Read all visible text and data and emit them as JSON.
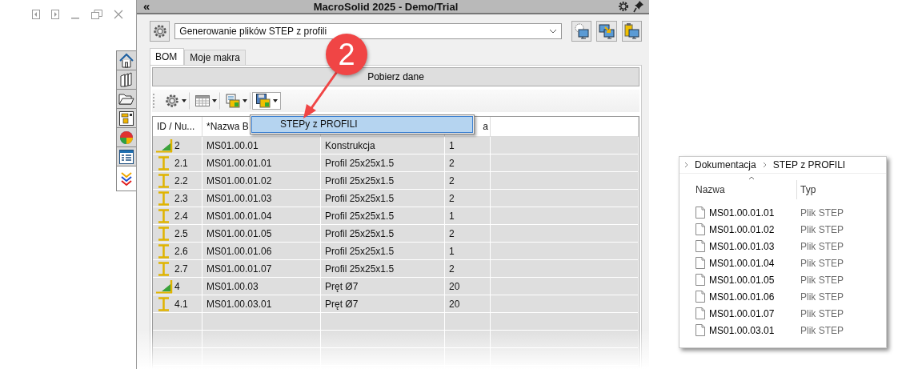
{
  "panel": {
    "collapse_glyph": "«",
    "title": "MacroSolid 2025 - Demo/Trial"
  },
  "side_tabs": [
    {
      "kind": "home",
      "selected": false
    },
    {
      "kind": "books",
      "selected": false
    },
    {
      "kind": "folder",
      "selected": false
    },
    {
      "kind": "layout",
      "selected": false
    },
    {
      "kind": "color",
      "selected": false
    },
    {
      "kind": "list",
      "selected": false
    },
    {
      "kind": "chevrons",
      "selected": true
    }
  ],
  "macro_combo": {
    "value": "Generowanie plików STEP z profili"
  },
  "tabs": [
    {
      "label": "BOM",
      "selected": true
    },
    {
      "label": "Moje makra",
      "selected": false
    }
  ],
  "fetch_button": {
    "label": "Pobierz dane"
  },
  "toolbar": [
    {
      "kind": "gear",
      "pressed": false
    },
    {
      "kind": "table",
      "pressed": false
    },
    {
      "kind": "export",
      "pressed": false
    },
    {
      "kind": "save",
      "pressed": true
    }
  ],
  "dropdown_menu": {
    "items": [
      {
        "label": "STEPy z PROFILI",
        "selected": true
      }
    ]
  },
  "table": {
    "columns": {
      "column_1": "ID / Nu...",
      "column_2": "*Nazwa B",
      "column_4": "a"
    },
    "rows": [
      {
        "kind": "assembly",
        "id": "2",
        "name": "MS01.00.01",
        "description": "Konstrukcja",
        "quantity": "1"
      },
      {
        "kind": "profile",
        "id": "2.1",
        "name": "MS01.00.01.01",
        "description": "Profil 25x25x1.5",
        "quantity": "2"
      },
      {
        "kind": "profile",
        "id": "2.2",
        "name": "MS01.00.01.02",
        "description": "Profil 25x25x1.5",
        "quantity": "2"
      },
      {
        "kind": "profile",
        "id": "2.3",
        "name": "MS01.00.01.03",
        "description": "Profil 25x25x1.5",
        "quantity": "2"
      },
      {
        "kind": "profile",
        "id": "2.4",
        "name": "MS01.00.01.04",
        "description": "Profil 25x25x1.5",
        "quantity": "1"
      },
      {
        "kind": "profile",
        "id": "2.5",
        "name": "MS01.00.01.05",
        "description": "Profil 25x25x1.5",
        "quantity": "2"
      },
      {
        "kind": "profile",
        "id": "2.6",
        "name": "MS01.00.01.06",
        "description": "Profil 25x25x1.5",
        "quantity": "1"
      },
      {
        "kind": "profile",
        "id": "2.7",
        "name": "MS01.00.01.07",
        "description": "Profil 25x25x1.5",
        "quantity": "2"
      },
      {
        "kind": "assembly",
        "id": "4",
        "name": "MS01.00.03",
        "description": "Pręt Ø7",
        "quantity": "20"
      },
      {
        "kind": "profile",
        "id": "4.1",
        "name": "MS01.00.03.01",
        "description": "Pręt Ø7",
        "quantity": "20"
      }
    ]
  },
  "callout": {
    "number": "2"
  },
  "explorer": {
    "breadcrumb": [
      "Dokumentacja",
      "STEP z PROFILI"
    ],
    "columns": [
      "Nazwa",
      "Typ"
    ],
    "files": [
      {
        "name": "MS01.00.01.01",
        "type": "Plik STEP"
      },
      {
        "name": "MS01.00.01.02",
        "type": "Plik STEP"
      },
      {
        "name": "MS01.00.01.03",
        "type": "Plik STEP"
      },
      {
        "name": "MS01.00.01.04",
        "type": "Plik STEP"
      },
      {
        "name": "MS01.00.01.05",
        "type": "Plik STEP"
      },
      {
        "name": "MS01.00.01.06",
        "type": "Plik STEP"
      },
      {
        "name": "MS01.00.01.07",
        "type": "Plik STEP"
      },
      {
        "name": "MS01.00.03.01",
        "type": "Plik STEP"
      }
    ]
  }
}
